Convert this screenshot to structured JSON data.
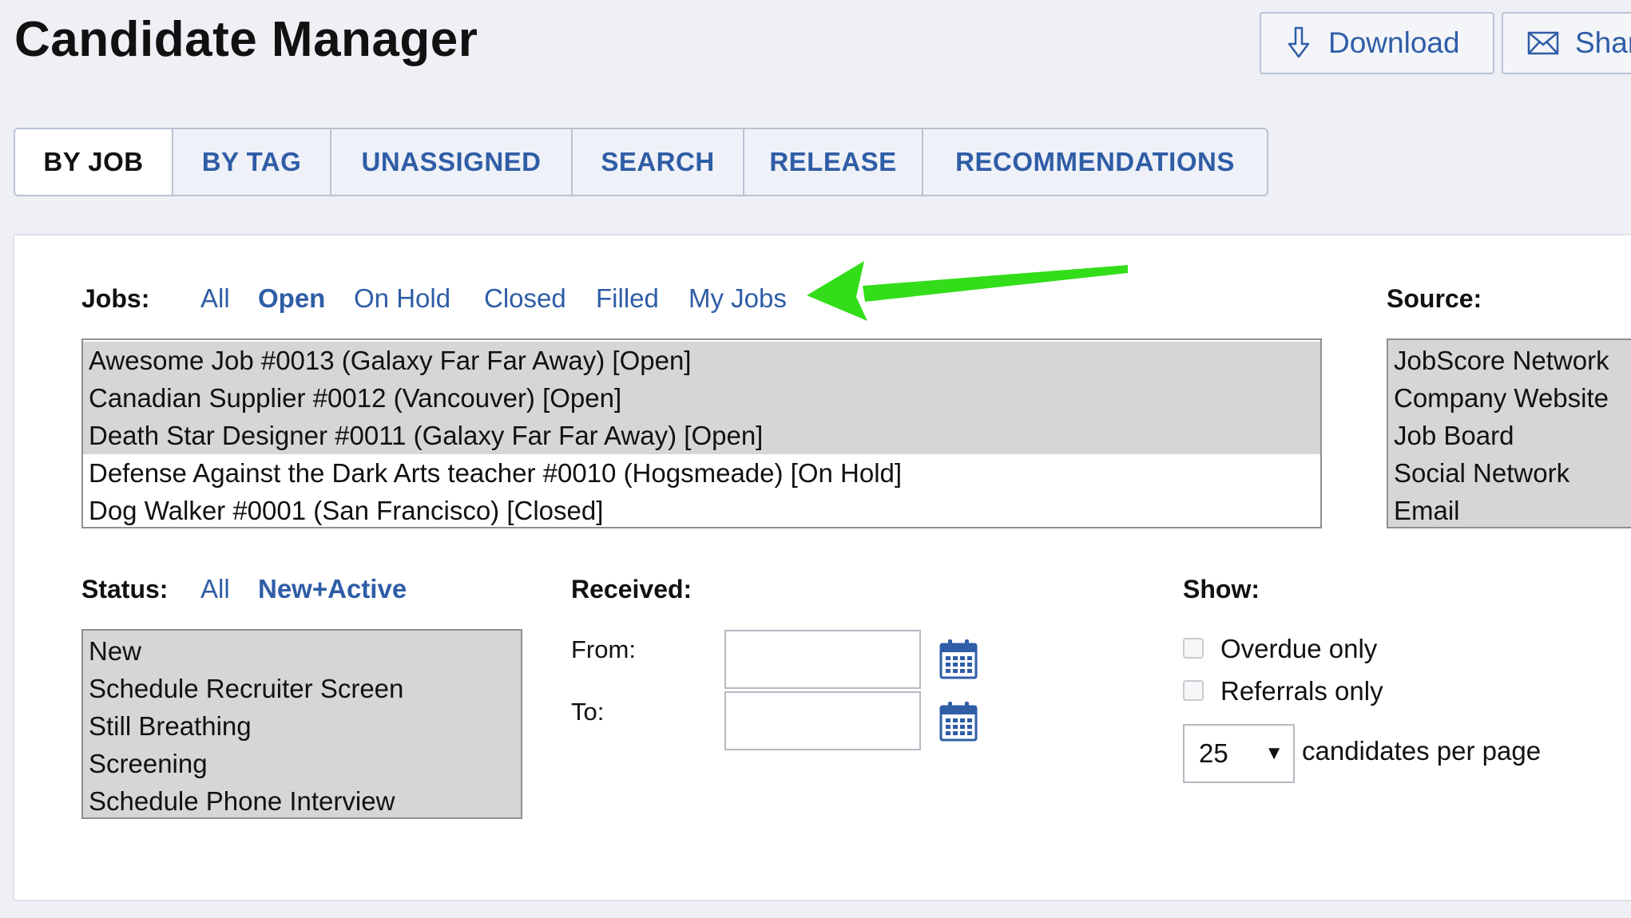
{
  "page": {
    "title": "Candidate Manager"
  },
  "header_buttons": {
    "download_label": "Download",
    "share_label": "Shar"
  },
  "tabs": [
    {
      "label": "BY JOB",
      "active": true
    },
    {
      "label": "BY TAG",
      "active": false
    },
    {
      "label": "UNASSIGNED",
      "active": false
    },
    {
      "label": "SEARCH",
      "active": false
    },
    {
      "label": "RELEASE",
      "active": false
    },
    {
      "label": "RECOMMENDATIONS",
      "active": false
    }
  ],
  "jobs": {
    "label": "Jobs:",
    "filters": [
      "All",
      "Open",
      "On Hold",
      "Closed",
      "Filled",
      "My Jobs"
    ],
    "active_filter": "Open",
    "items": [
      {
        "text": "Awesome Job #0013 (Galaxy Far Far Away) [Open]",
        "selected": true
      },
      {
        "text": "Canadian Supplier #0012 (Vancouver) [Open]",
        "selected": true
      },
      {
        "text": "Death Star Designer #0011 (Galaxy Far Far Away) [Open]",
        "selected": true
      },
      {
        "text": "Defense Against the Dark Arts teacher #0010 (Hogsmeade) [On Hold]",
        "selected": false
      },
      {
        "text": "Dog Walker #0001 (San Francisco) [Closed]",
        "selected": false
      }
    ]
  },
  "source": {
    "label": "Source:",
    "items": [
      "JobScore Network",
      "Company Website",
      "Job Board",
      "Social Network",
      "Email"
    ]
  },
  "status": {
    "label": "Status:",
    "filters": [
      "All",
      "New+Active"
    ],
    "active_filter": "New+Active",
    "items": [
      "New",
      "Schedule Recruiter Screen",
      "Still Breathing",
      "Screening",
      "Schedule Phone Interview"
    ]
  },
  "received": {
    "label": "Received:",
    "from_label": "From:",
    "to_label": "To:",
    "from_value": "",
    "to_value": ""
  },
  "show": {
    "label": "Show:",
    "overdue_label": "Overdue only",
    "referrals_label": "Referrals only",
    "overdue_checked": false,
    "referrals_checked": false,
    "per_page_value": "25",
    "per_page_suffix": "candidates per page"
  },
  "colors": {
    "link": "#2f5da6",
    "annotation_arrow": "#33dd1a",
    "selection": "#d6d6d6"
  },
  "icons": {
    "download": "download-arrow-icon",
    "share": "envelope-icon",
    "calendar": "calendar-icon",
    "annotation": "green-arrow-annotation"
  }
}
